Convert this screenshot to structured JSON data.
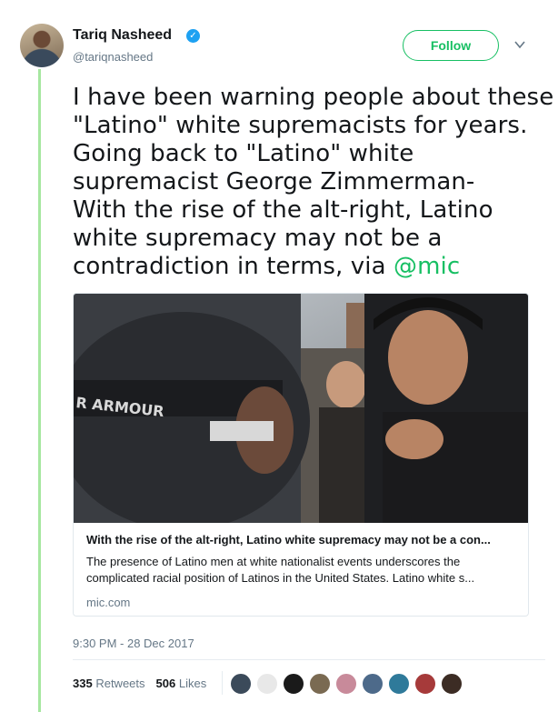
{
  "author": {
    "name": "Tariq Nasheed",
    "handle": "@tariqnasheed",
    "verified_glyph": "✓"
  },
  "follow_label": "Follow",
  "tweet": {
    "lines": [
      "I have been warning people about these",
      "\"Latino\" white supremacists for years.",
      "Going back to \"Latino\" white",
      "supremacist George Zimmerman-",
      "With the rise of the alt-right, Latino",
      "white supremacy may not be a"
    ],
    "last_line_text": "contradiction in terms, via ",
    "mention": "@mic"
  },
  "card": {
    "title": "With the rise of the alt-right, Latino white supremacy may not be a con...",
    "description_lines": [
      "The presence of Latino men at white nationalist events underscores the",
      "complicated racial position of Latinos in the United States. Latino white s..."
    ],
    "domain": "mic.com",
    "image_text": "R ARMOUR"
  },
  "timestamp": "9:30 PM - 28 Dec 2017",
  "stats": {
    "retweets_count": "335",
    "retweets_label": "Retweets",
    "likes_count": "506",
    "likes_label": "Likes"
  },
  "colors": {
    "accent": "#17bf63",
    "verified": "#1da1f2",
    "thread_line": "#a6e7a0",
    "muted": "#657786"
  },
  "icons": [
    "verified-badge-icon",
    "chevron-down-icon"
  ]
}
